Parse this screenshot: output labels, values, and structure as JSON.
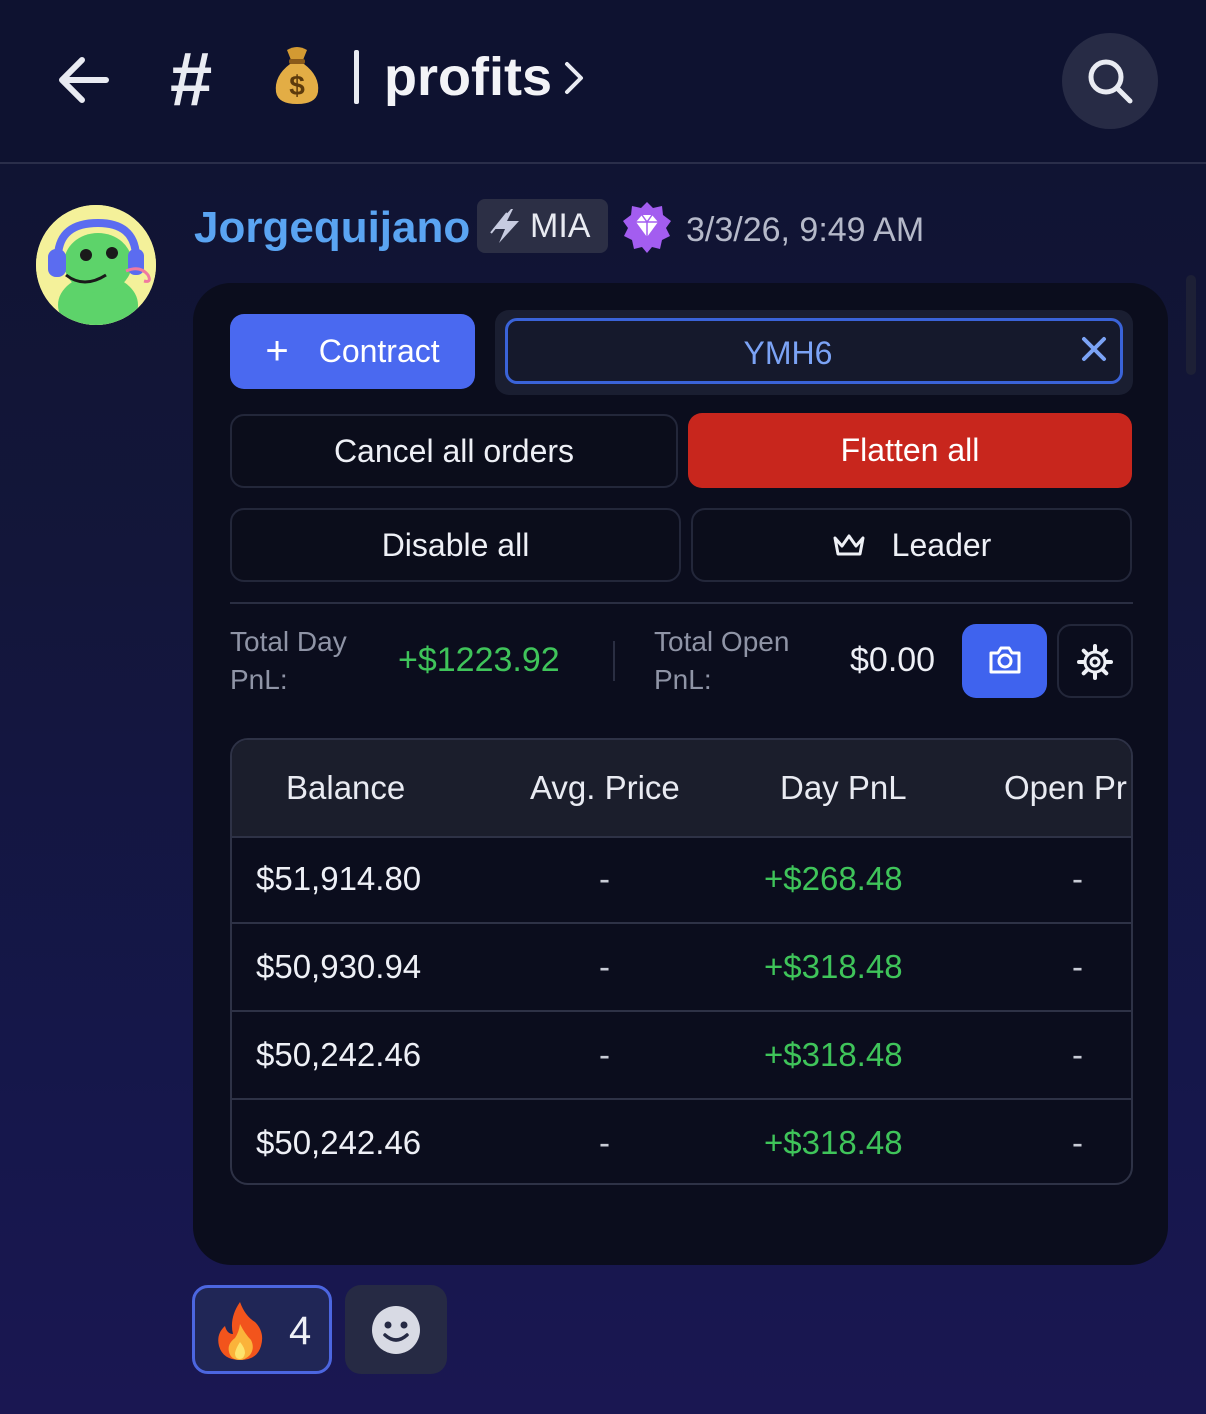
{
  "header": {
    "hash": "#",
    "emoji": "money-bag-icon",
    "separator": "|",
    "channel_name": "profits"
  },
  "message": {
    "username": "Jorgequijano",
    "tag_label": "MIA",
    "timestamp": "3/3/26, 9:49 AM"
  },
  "panel": {
    "contract_label": "Contract",
    "contract_value": "YMH6",
    "cancel_label": "Cancel all orders",
    "flatten_label": "Flatten all",
    "disable_label": "Disable all",
    "leader_label": "Leader",
    "total_day_label_1": "Total Day",
    "total_day_label_2": "PnL:",
    "total_day_value": "+$1223.92",
    "total_open_label_1": "Total Open",
    "total_open_label_2": "PnL:",
    "total_open_value": "$0.00"
  },
  "table": {
    "columns": [
      "Balance",
      "Avg. Price",
      "Day PnL",
      "Open Pr"
    ],
    "rows": [
      {
        "balance": "$51,914.80",
        "avg": "-",
        "day": "+$268.48",
        "open": "-"
      },
      {
        "balance": "$50,930.94",
        "avg": "-",
        "day": "+$318.48",
        "open": "-"
      },
      {
        "balance": "$50,242.46",
        "avg": "-",
        "day": "+$318.48",
        "open": "-"
      },
      {
        "balance": "$50,242.46",
        "avg": "-",
        "day": "+$318.48",
        "open": "-"
      }
    ]
  },
  "reactions": {
    "fire_count": "4"
  },
  "colors": {
    "accent": "#4a69f0",
    "danger": "#c8261d",
    "positive": "#3fc45a",
    "username": "#5aa4f2"
  }
}
